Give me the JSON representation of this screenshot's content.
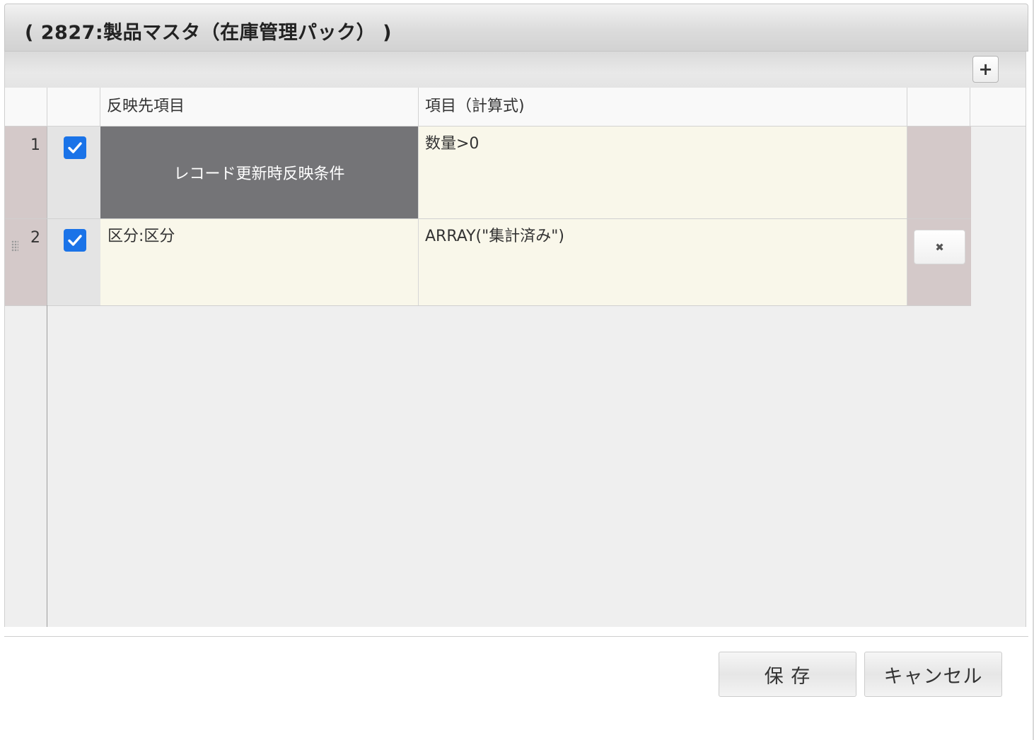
{
  "dialog": {
    "title": "( 2827:製品マスタ（在庫管理パック） )"
  },
  "toolbar": {
    "add_label": "+"
  },
  "columns": {
    "target": "反映先項目",
    "formula": "項目（計算式)"
  },
  "rows": [
    {
      "number": "1",
      "checked": true,
      "target": "レコード更新時反映条件",
      "formula": "数量>0"
    },
    {
      "number": "2",
      "checked": true,
      "target": "区分:区分",
      "formula": "ARRAY(\"集計済み\")",
      "delete_label": "✖"
    }
  ],
  "footer": {
    "save_label": "保 存",
    "cancel_label": "キャンセル"
  },
  "colors": {
    "checkbox": "#1a73e8",
    "highlight_cell": "#747477",
    "row_number_bg": "#d4c9c9",
    "cell_bg": "#f9f7ea"
  }
}
